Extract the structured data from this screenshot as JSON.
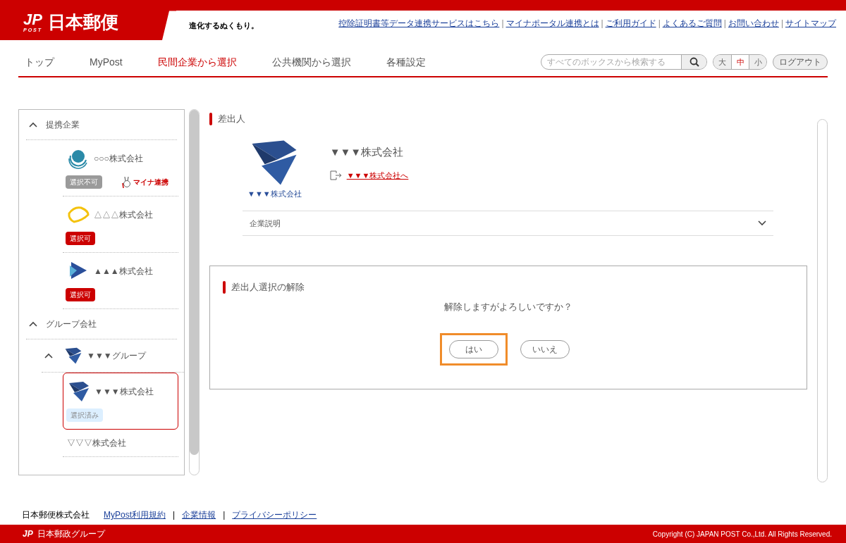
{
  "header": {
    "logo_mark": "JP",
    "logo_mark_sub": "POST",
    "logo_text": "日本郵便",
    "tagline": "進化するぬくもり。",
    "link_separator": "|",
    "links": [
      "控除証明書等データ連携サービスはこちら",
      "マイナポータル連携とは",
      "ご利用ガイド",
      "よくあるご質問",
      "お問い合わせ",
      "サイトマップ"
    ]
  },
  "nav": [
    {
      "label": "トップ",
      "selected": false
    },
    {
      "label": "MyPost",
      "selected": false
    },
    {
      "label": "民間企業から選択",
      "selected": true
    },
    {
      "label": "公共機関から選択",
      "selected": false
    },
    {
      "label": "各種設定",
      "selected": false
    }
  ],
  "search": {
    "placeholder": "すべてのボックスから検索する"
  },
  "font_size": [
    {
      "label": "大",
      "selected": false
    },
    {
      "label": "中",
      "selected": true
    },
    {
      "label": "小",
      "selected": false
    }
  ],
  "logout": "ログアウト",
  "sidebar": {
    "sections": [
      {
        "title": "提携企業",
        "expanded": true,
        "children": [
          {
            "kind": "company",
            "name": "○○○株式会社",
            "logo": {
              "kind": "ring"
            },
            "selected": false,
            "badge": {
              "kind": "unavailable",
              "label": "選択不可"
            },
            "tag": "マイナ連携"
          },
          {
            "kind": "company",
            "name": "△△△株式会社",
            "logo": {
              "kind": "lens"
            },
            "selected": false,
            "badge": {
              "kind": "available",
              "label": "選択可"
            }
          },
          {
            "kind": "company",
            "name": "▲▲▲株式会社",
            "logo": {
              "kind": "triangle"
            },
            "selected": false,
            "badge": {
              "kind": "available",
              "label": "選択可"
            }
          }
        ]
      },
      {
        "title": "グループ会社",
        "expanded": true,
        "children": [
          {
            "kind": "group",
            "name": "▼▼▼グループ",
            "logo": {
              "kind": "prism"
            },
            "expanded": true,
            "children": [
              {
                "kind": "company",
                "name": "▼▼▼株式会社",
                "logo": {
                  "kind": "prism"
                },
                "selected": true,
                "badge": {
                  "kind": "selected",
                  "label": "選択済み"
                }
              },
              {
                "kind": "company",
                "name": "▽▽▽株式会社",
                "selected": false
              }
            ]
          }
        ]
      }
    ]
  },
  "sender": {
    "title": "差出人",
    "name": "▼▼▼株式会社",
    "logo_caption": "▼▼▼株式会社",
    "link": "▼▼▼株式会社へ",
    "description": {
      "label": "企業説明",
      "expanded": false
    }
  },
  "dialog": {
    "title": "差出人選択の解除",
    "message": "解除しますがよろしいですか？",
    "buttons": [
      {
        "label": "はい",
        "focused": true
      },
      {
        "label": "いいえ",
        "focused": false
      }
    ]
  },
  "footer": {
    "company": "日本郵便株式会社",
    "link_separator": "|",
    "links": [
      "MyPost利用規約",
      "企業情報",
      "プライバシーポリシー"
    ],
    "group_logo_mark": "JP",
    "group_name": "日本郵政グループ",
    "copyright": "Copyright (C) JAPAN POST Co.,Ltd. All Rights Reserved."
  }
}
